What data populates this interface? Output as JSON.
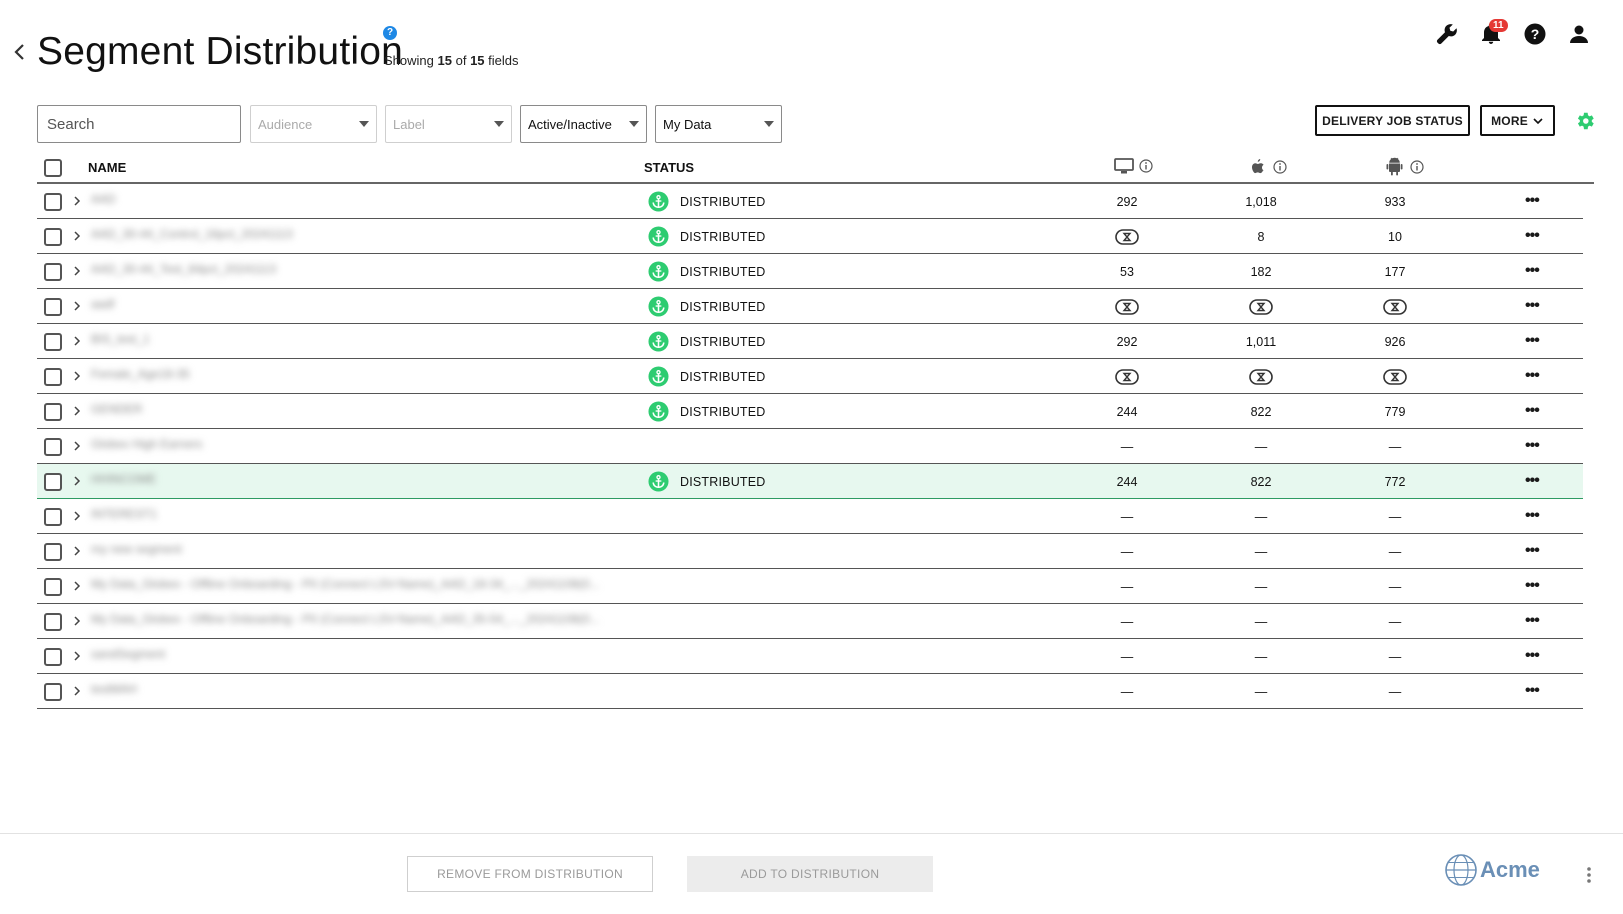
{
  "header": {
    "title": "Segment Distribution",
    "help": "?",
    "showing_prefix": "Showing",
    "showing_count": "15",
    "showing_of": "of",
    "showing_total": "15",
    "showing_suffix": "fields",
    "notification_count": "11"
  },
  "filters": {
    "search_placeholder": "Search",
    "audience": "Audience",
    "label": "Label",
    "active": "Active/Inactive",
    "data": "My Data"
  },
  "actions": {
    "delivery": "DELIVERY JOB STATUS",
    "more": "MORE"
  },
  "table": {
    "headers": {
      "name": "NAME",
      "status": "STATUS"
    },
    "rows": [
      {
        "name": "AAD",
        "status": "DISTRIBUTED",
        "desktop": "292",
        "ios": "1,018",
        "android": "933",
        "highlight": false
      },
      {
        "name": "AAD_30-44_Control_16pct_20241113",
        "status": "DISTRIBUTED",
        "desktop": "PENDING",
        "ios": "8",
        "android": "10",
        "highlight": false
      },
      {
        "name": "AAD_30-44_Test_84pct_20241113",
        "status": "DISTRIBUTED",
        "desktop": "53",
        "ios": "182",
        "android": "177",
        "highlight": false
      },
      {
        "name": "aadf",
        "status": "DISTRIBUTED",
        "desktop": "PENDING",
        "ios": "PENDING",
        "android": "PENDING",
        "highlight": false
      },
      {
        "name": "BIS_test_1",
        "status": "DISTRIBUTED",
        "desktop": "292",
        "ios": "1,011",
        "android": "926",
        "highlight": false
      },
      {
        "name": "Female_Age18-35",
        "status": "DISTRIBUTED",
        "desktop": "PENDING",
        "ios": "PENDING",
        "android": "PENDING",
        "highlight": false
      },
      {
        "name": "GENDER",
        "status": "DISTRIBUTED",
        "desktop": "244",
        "ios": "822",
        "android": "779",
        "highlight": false
      },
      {
        "name": "Globex High Earners",
        "status": "",
        "desktop": "—",
        "ios": "—",
        "android": "—",
        "highlight": false
      },
      {
        "name": "HHINCOME",
        "status": "DISTRIBUTED",
        "desktop": "244",
        "ios": "822",
        "android": "772",
        "highlight": true
      },
      {
        "name": "INTEREST1",
        "status": "",
        "desktop": "—",
        "ios": "—",
        "android": "—",
        "highlight": false
      },
      {
        "name": "my new segment",
        "status": "",
        "desktop": "—",
        "ios": "—",
        "android": "—",
        "highlight": false
      },
      {
        "name": "My Data_Globex - Offline Onboarding - PII (Connect LSV-Name)_AAD_18-34_..._20241108(0...",
        "status": "",
        "desktop": "—",
        "ios": "—",
        "android": "—",
        "highlight": false
      },
      {
        "name": "My Data_Globex - Offline Onboarding - PII (Connect LSV-Name)_AAD_35-54_..._20241108(0...",
        "status": "",
        "desktop": "—",
        "ios": "—",
        "android": "—",
        "highlight": false
      },
      {
        "name": "sandSegment",
        "status": "",
        "desktop": "—",
        "ios": "—",
        "android": "—",
        "highlight": false
      },
      {
        "name": "testMAH",
        "status": "",
        "desktop": "—",
        "ios": "—",
        "android": "—",
        "highlight": false
      }
    ]
  },
  "footer": {
    "remove": "REMOVE FROM DISTRIBUTION",
    "add": "ADD TO DISTRIBUTION",
    "brand": "Acme"
  },
  "colors": {
    "distributed": "#2ecc71",
    "highlight_bg": "#e7f8ef",
    "badge": "#e53935",
    "gear": "#2ecc71",
    "brand": "#6a8fb6"
  }
}
